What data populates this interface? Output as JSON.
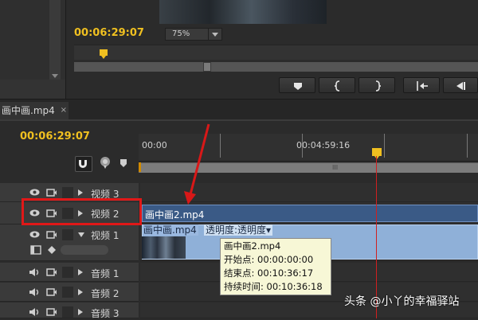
{
  "monitor": {
    "timecode": "00:06:29:07",
    "zoom_value": "75%",
    "transport_buttons": [
      "add-marker",
      "mark-in",
      "mark-out",
      "go-to-in",
      "step-back"
    ]
  },
  "sequence": {
    "tab_label": "画中画.mp4",
    "tab_close": "×",
    "timecode": "00:06:29:07",
    "ruler_labels": [
      "00:00",
      "00:04:59:16"
    ],
    "scroll_grip": "III"
  },
  "tracks": {
    "video3": "视频 3",
    "video2": "视频 2",
    "video1": "视频 1",
    "audio1": "音频 1",
    "audio2": "音频 2",
    "audio3": "音频 3"
  },
  "clips": {
    "v2_name": "画中画2.mp4",
    "v1_name": "画中画.mp4",
    "v1_opacity": "透明度:透明度▾"
  },
  "tooltip": {
    "title": "画中画2.mp4",
    "start": "开始点: 00:00:00:00",
    "end": "结束点: 00:10:36:17",
    "duration": "持续时间: 00:10:36:18"
  },
  "watermark": "头条 @小丫的幸福驿站",
  "colors": {
    "timecode": "#f0c020",
    "highlight": "#e01818",
    "playhead": "#d02020",
    "clip_v2": "#3a5a86",
    "clip_v1": "#8fb0d8"
  }
}
